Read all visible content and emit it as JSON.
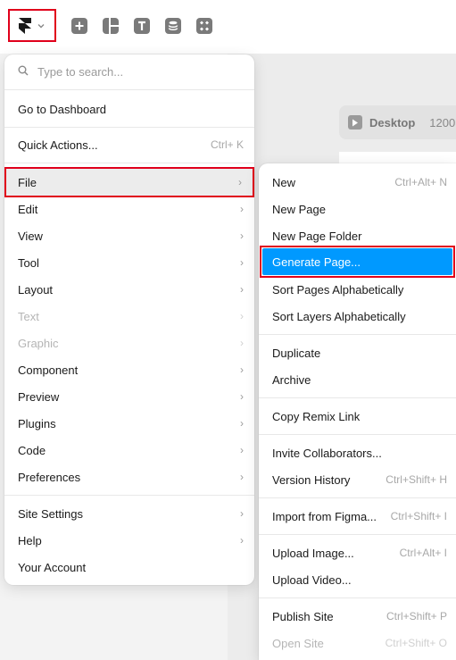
{
  "toolbar": {
    "icons": [
      "framer-logo-icon",
      "chevron-down-icon",
      "insert-icon",
      "layout-icon",
      "text-icon",
      "cms-icon",
      "assets-icon"
    ]
  },
  "canvas": {
    "breakpoint_label": "Desktop",
    "breakpoint_width": "1200"
  },
  "menu": {
    "search_placeholder": "Type to search...",
    "go_to_dashboard": "Go to Dashboard",
    "quick_actions": {
      "label": "Quick Actions...",
      "shortcut": "Ctrl+ K"
    },
    "items": [
      {
        "label": "File"
      },
      {
        "label": "Edit"
      },
      {
        "label": "View"
      },
      {
        "label": "Tool"
      },
      {
        "label": "Layout"
      },
      {
        "label": "Text"
      },
      {
        "label": "Graphic"
      },
      {
        "label": "Component"
      },
      {
        "label": "Preview"
      },
      {
        "label": "Plugins"
      },
      {
        "label": "Code"
      },
      {
        "label": "Preferences"
      }
    ],
    "footer": [
      {
        "label": "Site Settings"
      },
      {
        "label": "Help"
      },
      {
        "label": "Your Account"
      }
    ]
  },
  "submenu": {
    "new": {
      "label": "New",
      "shortcut": "Ctrl+Alt+ N"
    },
    "new_page": "New Page",
    "new_page_folder": "New Page Folder",
    "generate_page": "Generate Page...",
    "sort_pages": "Sort Pages Alphabetically",
    "sort_layers": "Sort Layers Alphabetically",
    "duplicate": "Duplicate",
    "archive": "Archive",
    "copy_remix": "Copy Remix Link",
    "invite": "Invite Collaborators...",
    "version_history": {
      "label": "Version History",
      "shortcut": "Ctrl+Shift+ H"
    },
    "import_figma": {
      "label": "Import from Figma...",
      "shortcut": "Ctrl+Shift+ I"
    },
    "upload_image": {
      "label": "Upload Image...",
      "shortcut": "Ctrl+Alt+ I"
    },
    "upload_video": "Upload Video...",
    "publish_site": {
      "label": "Publish Site",
      "shortcut": "Ctrl+Shift+ P"
    },
    "open_site": {
      "label": "Open Site",
      "shortcut": "Ctrl+Shift+ O"
    }
  },
  "colors": {
    "accent": "#0099ff",
    "highlight_outline": "#e0001b"
  }
}
